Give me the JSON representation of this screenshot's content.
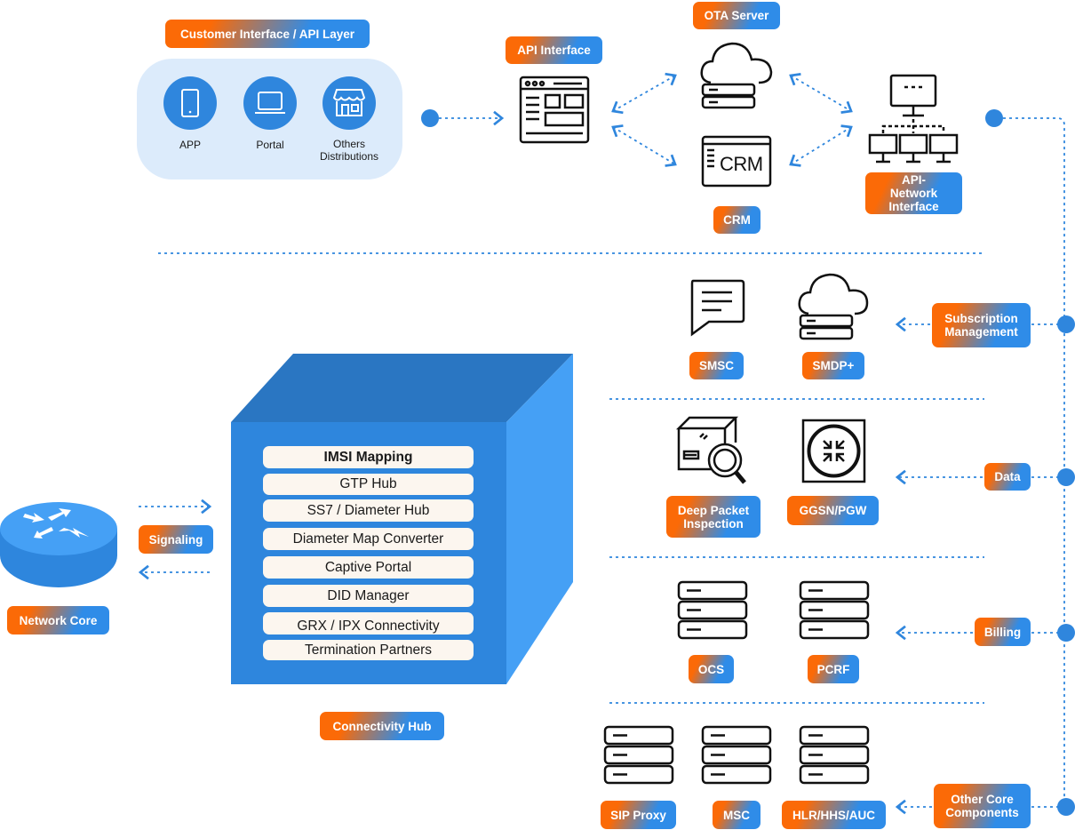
{
  "colors": {
    "accent_orange": "#fb6a07",
    "accent_blue": "#2f8ce8",
    "cube_front": "#2e86dd",
    "cube_top": "#2a76c2",
    "cube_side": "#45a0f5",
    "panel": "#dcebfb",
    "item_bg": "#fcf6ef"
  },
  "customer": {
    "title": "Customer Interface / API Layer",
    "items": [
      {
        "label": "APP",
        "icon": "smartphone-icon"
      },
      {
        "label": "Portal",
        "icon": "laptop-icon"
      },
      {
        "label": "Others Distributions",
        "icon": "storefront-icon"
      }
    ]
  },
  "api_interface": {
    "label": "API Interface",
    "icon": "browser-window-icon"
  },
  "ota_server": {
    "label": "OTA Server",
    "icon": "cloud-server-icon"
  },
  "crm": {
    "label": "CRM",
    "icon_text": "CRM"
  },
  "api_network": {
    "label": "API-Network Interface",
    "icon": "network-computers-icon"
  },
  "subscription": {
    "label": "Subscription Management",
    "nodes": [
      {
        "label": "SMSC",
        "icon": "chat-bubble-icon"
      },
      {
        "label": "SMDP+",
        "icon": "cloud-server-icon"
      }
    ]
  },
  "data": {
    "label": "Data",
    "nodes": [
      {
        "label": "Deep Packet Inspection",
        "icon": "package-search-icon"
      },
      {
        "label": "GGSN/PGW",
        "icon": "gateway-arrows-icon"
      }
    ]
  },
  "billing": {
    "label": "Billing",
    "nodes": [
      {
        "label": "OCS",
        "icon": "server-icon"
      },
      {
        "label": "PCRF",
        "icon": "server-icon"
      }
    ]
  },
  "other_core": {
    "label": "Other Core Components",
    "nodes": [
      {
        "label": "SIP Proxy",
        "icon": "server-icon"
      },
      {
        "label": "MSC",
        "icon": "server-icon"
      },
      {
        "label": "HLR/HHS/AUC",
        "icon": "server-icon"
      }
    ]
  },
  "network_core": {
    "label": "Network Core",
    "icon": "router-icon"
  },
  "signaling": {
    "label": "Signaling"
  },
  "hub": {
    "label": "Connectivity Hub",
    "items": [
      "IMSI Mapping",
      "GTP Hub",
      "SS7 / Diameter Hub",
      "Diameter Map Converter",
      "Captive Portal",
      "DID Manager",
      "GRX / IPX Connectivity",
      "Termination Partners"
    ]
  }
}
